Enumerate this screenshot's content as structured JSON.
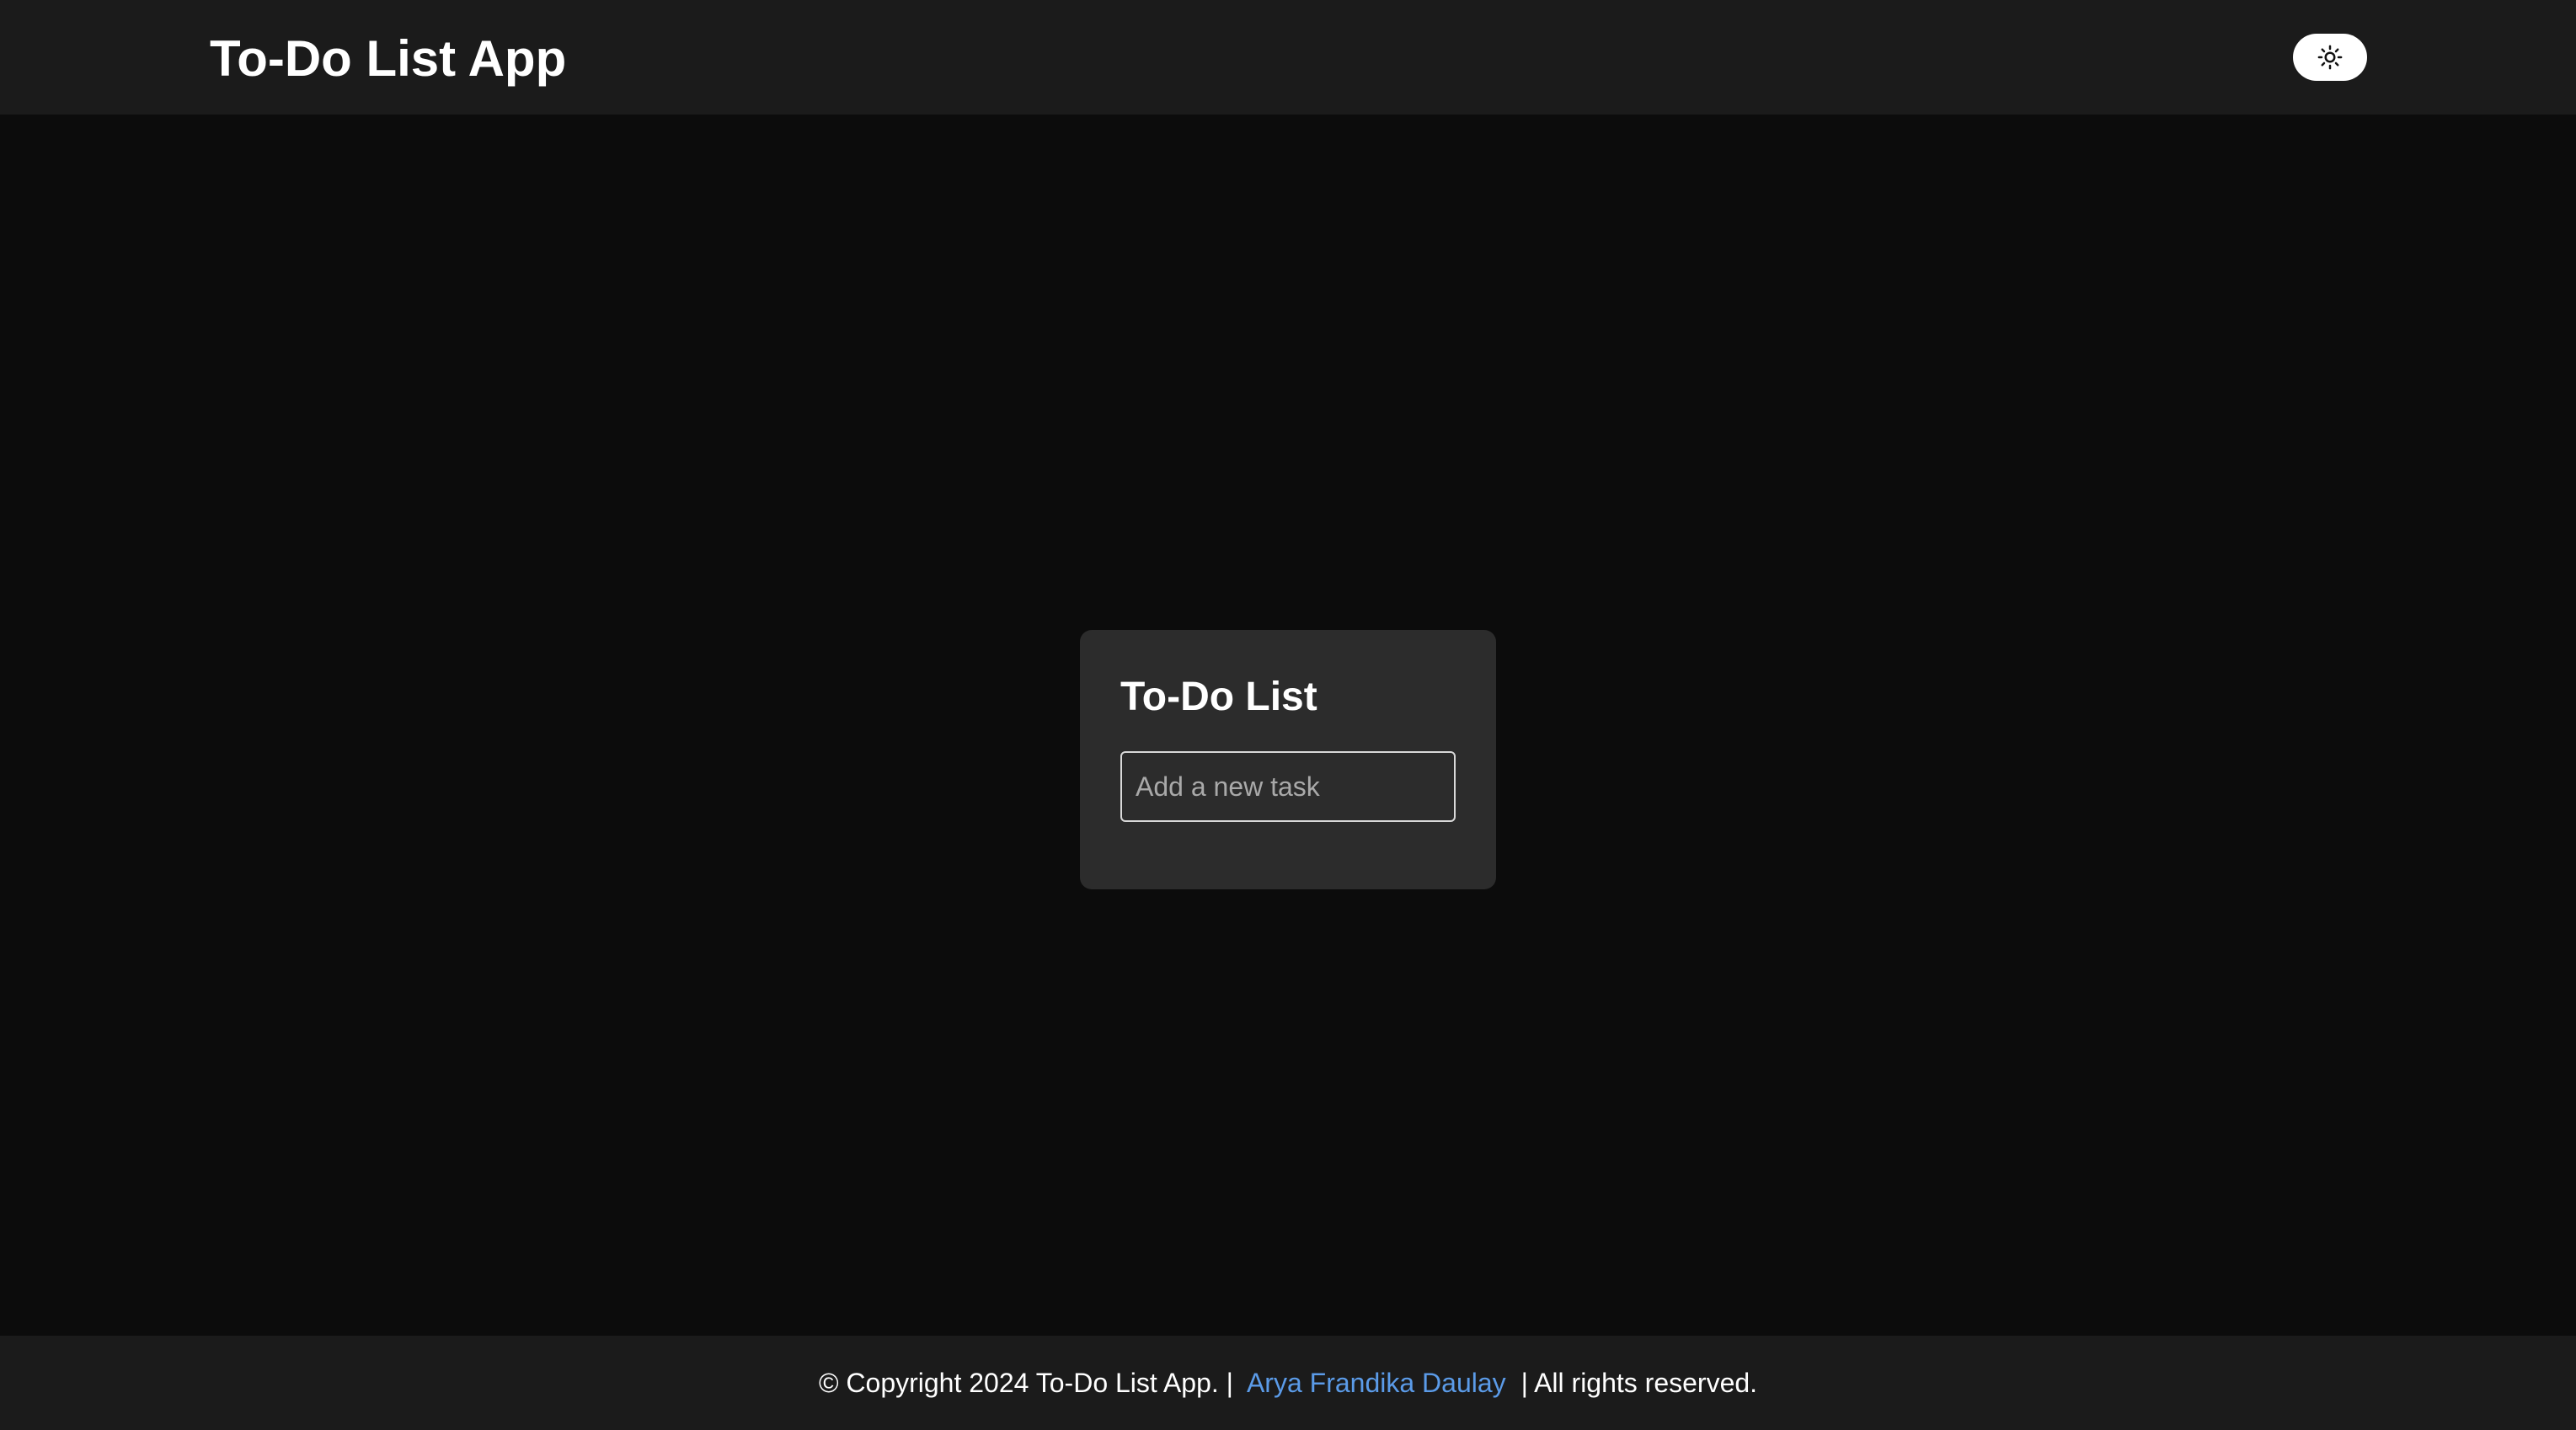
{
  "navbar": {
    "brand": "To-Do List App",
    "theme_toggle_icon": "sun-icon"
  },
  "card": {
    "title": "To-Do List",
    "input_placeholder": "Add a new task",
    "input_value": ""
  },
  "footer": {
    "prefix": "© Copyright 2024 To-Do List App. |",
    "author_link": "Arya Frandika Daulay",
    "suffix": "| All rights reserved."
  },
  "colors": {
    "background": "#0c0c0c",
    "navbar": "#1b1b1b",
    "card": "#2c2c2c",
    "link": "#5b9be8",
    "toggle": "#ffffff"
  }
}
